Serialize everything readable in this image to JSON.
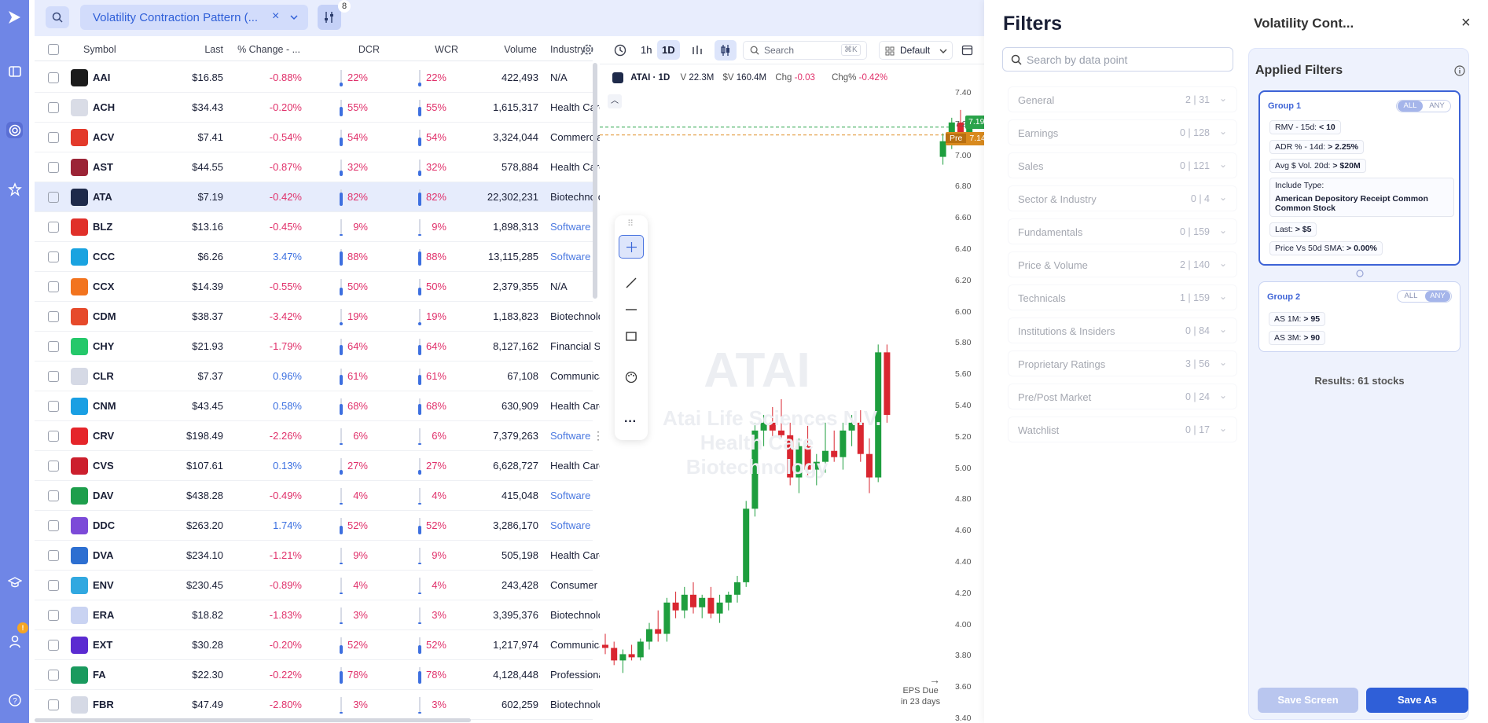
{
  "toolbar": {
    "screen_name": "Volatility Contraction Pattern (...",
    "filter_count": "8"
  },
  "table": {
    "headers": {
      "symbol": "Symbol",
      "last": "Last",
      "change": "% Change - ...",
      "dcr": "DCR",
      "wcr": "WCR",
      "volume": "Volume",
      "industry": "Industry"
    },
    "rows": [
      {
        "symbol": "AAI",
        "last": "$16.85",
        "change": "-0.88%",
        "dcr": "22%",
        "dcr_value": 22,
        "wcr": "22%",
        "volume": "422,493",
        "industry": "N/A",
        "logo_color": "#1b1b1b",
        "negative": true,
        "industry_link": false
      },
      {
        "symbol": "ACH",
        "last": "$34.43",
        "change": "-0.20%",
        "dcr": "55%",
        "dcr_value": 55,
        "wcr": "55%",
        "volume": "1,615,317",
        "industry": "Health Care ...",
        "logo_color": "#d9dce6",
        "negative": true,
        "industry_link": false
      },
      {
        "symbol": "ACV",
        "last": "$7.41",
        "change": "-0.54%",
        "dcr": "54%",
        "dcr_value": 54,
        "wcr": "54%",
        "volume": "3,324,044",
        "industry": "Commercial ...",
        "logo_color": "#e33a2b",
        "negative": true,
        "industry_link": false
      },
      {
        "symbol": "AST",
        "last": "$44.55",
        "change": "-0.87%",
        "dcr": "32%",
        "dcr_value": 32,
        "wcr": "32%",
        "volume": "578,884",
        "industry": "Health Care ...",
        "logo_color": "#9b2436",
        "negative": true,
        "industry_link": false
      },
      {
        "symbol": "ATA",
        "last": "$7.19",
        "change": "-0.42%",
        "dcr": "82%",
        "dcr_value": 82,
        "wcr": "82%",
        "volume": "22,302,231",
        "industry": "Biotechnology",
        "logo_color": "#1e2a4a",
        "negative": true,
        "industry_link": false,
        "selected": true
      },
      {
        "symbol": "BLZ",
        "last": "$13.16",
        "change": "-0.45%",
        "dcr": "9%",
        "dcr_value": 9,
        "wcr": "9%",
        "volume": "1,898,313",
        "industry": "Software",
        "logo_color": "#e0302a",
        "negative": true,
        "industry_link": true
      },
      {
        "symbol": "CCC",
        "last": "$6.26",
        "change": "3.47%",
        "dcr": "88%",
        "dcr_value": 88,
        "wcr": "88%",
        "volume": "13,115,285",
        "industry": "Software",
        "logo_color": "#1aa3e0",
        "negative": false,
        "industry_link": true
      },
      {
        "symbol": "CCX",
        "last": "$14.39",
        "change": "-0.55%",
        "dcr": "50%",
        "dcr_value": 50,
        "wcr": "50%",
        "volume": "2,379,355",
        "industry": "N/A",
        "logo_color": "#f2741f",
        "negative": true,
        "industry_link": false
      },
      {
        "symbol": "CDM",
        "last": "$38.37",
        "change": "-3.42%",
        "dcr": "19%",
        "dcr_value": 19,
        "wcr": "19%",
        "volume": "1,183,823",
        "industry": "Biotechnology",
        "logo_color": "#e64a2b",
        "negative": true,
        "industry_link": false
      },
      {
        "symbol": "CHY",
        "last": "$21.93",
        "change": "-1.79%",
        "dcr": "64%",
        "dcr_value": 64,
        "wcr": "64%",
        "volume": "8,127,162",
        "industry": "Financial Ser...",
        "logo_color": "#25c86a",
        "negative": true,
        "industry_link": false
      },
      {
        "symbol": "CLR",
        "last": "$7.37",
        "change": "0.96%",
        "dcr": "61%",
        "dcr_value": 61,
        "wcr": "61%",
        "volume": "67,108",
        "industry": "Communicati...",
        "logo_color": "#d5d9e5",
        "negative": false,
        "industry_link": false
      },
      {
        "symbol": "CNM",
        "last": "$43.45",
        "change": "0.58%",
        "dcr": "68%",
        "dcr_value": 68,
        "wcr": "68%",
        "volume": "630,909",
        "industry": "Health Care ...",
        "logo_color": "#1a9fe3",
        "negative": false,
        "industry_link": false
      },
      {
        "symbol": "CRV",
        "last": "$198.49",
        "change": "-2.26%",
        "dcr": "6%",
        "dcr_value": 6,
        "wcr": "6%",
        "volume": "7,379,263",
        "industry": "Software",
        "logo_color": "#e5252a",
        "negative": true,
        "industry_link": true
      },
      {
        "symbol": "CVS",
        "last": "$107.61",
        "change": "0.13%",
        "dcr": "27%",
        "dcr_value": 27,
        "wcr": "27%",
        "volume": "6,628,727",
        "industry": "Health Care ...",
        "logo_color": "#cc1f2d",
        "negative": false,
        "industry_link": false
      },
      {
        "symbol": "DAV",
        "last": "$438.28",
        "change": "-0.49%",
        "dcr": "4%",
        "dcr_value": 4,
        "wcr": "4%",
        "volume": "415,048",
        "industry": "Software",
        "logo_color": "#1e9e4c",
        "negative": true,
        "industry_link": true
      },
      {
        "symbol": "DDC",
        "last": "$263.20",
        "change": "1.74%",
        "dcr": "52%",
        "dcr_value": 52,
        "wcr": "52%",
        "volume": "3,286,170",
        "industry": "Software",
        "logo_color": "#7c4ad8",
        "negative": false,
        "industry_link": true
      },
      {
        "symbol": "DVA",
        "last": "$234.10",
        "change": "-1.21%",
        "dcr": "9%",
        "dcr_value": 9,
        "wcr": "9%",
        "volume": "505,198",
        "industry": "Health Care ...",
        "logo_color": "#2d6fd1",
        "negative": true,
        "industry_link": false
      },
      {
        "symbol": "ENV",
        "last": "$230.45",
        "change": "-0.89%",
        "dcr": "4%",
        "dcr_value": 4,
        "wcr": "4%",
        "volume": "243,428",
        "industry": "Consumer Fi...",
        "logo_color": "#31a8e0",
        "negative": true,
        "industry_link": false
      },
      {
        "symbol": "ERA",
        "last": "$18.82",
        "change": "-1.83%",
        "dcr": "3%",
        "dcr_value": 3,
        "wcr": "3%",
        "volume": "3,395,376",
        "industry": "Biotechnology",
        "logo_color": "#c9d3f2",
        "negative": true,
        "industry_link": false
      },
      {
        "symbol": "EXT",
        "last": "$30.28",
        "change": "-0.20%",
        "dcr": "52%",
        "dcr_value": 52,
        "wcr": "52%",
        "volume": "1,217,974",
        "industry": "Communicati...",
        "logo_color": "#5b2bd1",
        "negative": true,
        "industry_link": false
      },
      {
        "symbol": "FA",
        "last": "$22.30",
        "change": "-0.22%",
        "dcr": "78%",
        "dcr_value": 78,
        "wcr": "78%",
        "volume": "4,128,448",
        "industry": "Professional ...",
        "logo_color": "#1a9a5e",
        "negative": true,
        "industry_link": false
      },
      {
        "symbol": "FBR",
        "last": "$47.49",
        "change": "-2.80%",
        "dcr": "3%",
        "dcr_value": 3,
        "wcr": "3%",
        "volume": "602,259",
        "industry": "Biotechnology",
        "logo_color": "#d5d9e5",
        "negative": true,
        "industry_link": false
      }
    ]
  },
  "chart": {
    "interval_1h": "1h",
    "interval_1d": "1D",
    "search_placeholder": "Search",
    "search_shortcut": "⌘K",
    "layout": "Default",
    "symbol": "ATAI · 1D",
    "v_label": "V",
    "volume": "22.3M",
    "dollar_label": "$V",
    "dollar_volume": "160.4M",
    "chg_label": "Chg",
    "chg": "-0.03",
    "chgp_label": "Chg%",
    "chgp": "-0.42%",
    "watermark_ticker": "ATAI",
    "watermark_line1": "Atai Life Sciences N.V.",
    "watermark_line2": "Health Care",
    "watermark_line3": "Biotechnology",
    "price_tag": "7.19",
    "pre_label": "Pre",
    "pre_price": "7.14",
    "eps_line1": "EPS Due",
    "eps_line2": "in 23 days",
    "y_ticks": [
      "7.40",
      "7.20",
      "7.00",
      "6.80",
      "6.60",
      "6.40",
      "6.20",
      "6.00",
      "5.80",
      "5.60",
      "5.40",
      "5.20",
      "5.00",
      "4.80",
      "4.60",
      "4.40",
      "4.20",
      "4.00",
      "3.80",
      "3.60",
      "3.40"
    ]
  },
  "filters": {
    "title": "Filters",
    "search_placeholder": "Search by data point",
    "screen_title": "Volatility Cont...",
    "categories": [
      {
        "name": "General",
        "active": "2",
        "total": "31"
      },
      {
        "name": "Earnings",
        "active": "0",
        "total": "128"
      },
      {
        "name": "Sales",
        "active": "0",
        "total": "121"
      },
      {
        "name": "Sector & Industry",
        "active": "0",
        "total": "4"
      },
      {
        "name": "Fundamentals",
        "active": "0",
        "total": "159"
      },
      {
        "name": "Price & Volume",
        "active": "2",
        "total": "140"
      },
      {
        "name": "Technicals",
        "active": "1",
        "total": "159"
      },
      {
        "name": "Institutions & Insiders",
        "active": "0",
        "total": "84"
      },
      {
        "name": "Proprietary Ratings",
        "active": "3",
        "total": "56"
      },
      {
        "name": "Pre/Post Market",
        "active": "0",
        "total": "24"
      },
      {
        "name": "Watchlist",
        "active": "0",
        "total": "17"
      }
    ],
    "applied_title": "Applied Filters",
    "group1": {
      "title": "Group 1",
      "all": "ALL",
      "any": "ANY",
      "rmv_label": "RMV - 15d:",
      "rmv_val": "< 10",
      "adr_label": "ADR % - 14d:",
      "adr_val": "> 2.25%",
      "avg_label": "Avg $ Vol. 20d:",
      "avg_val": "> $20M",
      "include_label": "Include Type:",
      "include_val1": "American Depository Receipt Common",
      "include_val2": "Common Stock",
      "last_label": "Last:",
      "last_val": "> $5",
      "sma_label": "Price Vs 50d SMA:",
      "sma_val": "> 0.00%"
    },
    "group2": {
      "title": "Group 2",
      "all": "ALL",
      "any": "ANY",
      "as1_label": "AS 1M:",
      "as1_val": "> 95",
      "as3_label": "AS 3M:",
      "as3_val": "> 90"
    },
    "results": "Results: 61 stocks",
    "save_screen": "Save Screen",
    "save_as": "Save As"
  },
  "candles": [
    [
      3.88,
      3.95,
      3.82,
      3.86
    ],
    [
      3.86,
      3.9,
      3.75,
      3.78
    ],
    [
      3.78,
      3.85,
      3.7,
      3.82
    ],
    [
      3.82,
      3.88,
      3.78,
      3.8
    ],
    [
      3.8,
      3.92,
      3.78,
      3.9
    ],
    [
      3.9,
      4.02,
      3.85,
      3.98
    ],
    [
      3.98,
      4.1,
      3.9,
      3.95
    ],
    [
      3.95,
      4.18,
      3.9,
      4.15
    ],
    [
      4.15,
      4.22,
      4.05,
      4.1
    ],
    [
      4.1,
      4.25,
      4.05,
      4.2
    ],
    [
      4.2,
      4.28,
      4.08,
      4.12
    ],
    [
      4.12,
      4.2,
      4.05,
      4.18
    ],
    [
      4.18,
      4.25,
      4.05,
      4.08
    ],
    [
      4.08,
      4.2,
      4.02,
      4.15
    ],
    [
      4.15,
      4.22,
      4.1,
      4.2
    ],
    [
      4.2,
      4.32,
      4.15,
      4.28
    ],
    [
      4.28,
      4.8,
      4.25,
      4.75
    ],
    [
      4.75,
      5.3,
      4.7,
      5.25
    ],
    [
      5.25,
      5.35,
      5.15,
      5.3
    ],
    [
      5.3,
      5.4,
      5.2,
      5.25
    ],
    [
      5.25,
      5.45,
      5.2,
      5.22
    ],
    [
      5.22,
      5.3,
      4.9,
      4.95
    ],
    [
      4.95,
      5.2,
      4.85,
      5.15
    ],
    [
      5.15,
      5.28,
      4.95,
      5.0
    ],
    [
      5.0,
      5.1,
      4.9,
      5.05
    ],
    [
      5.05,
      5.3,
      4.98,
      5.12
    ],
    [
      5.12,
      5.25,
      5.05,
      5.08
    ],
    [
      5.08,
      5.3,
      5.0,
      5.25
    ],
    [
      5.25,
      5.35,
      5.15,
      5.3
    ],
    [
      5.3,
      5.38,
      5.05,
      5.1
    ],
    [
      5.1,
      5.2,
      4.85,
      4.95
    ],
    [
      4.95,
      5.8,
      4.92,
      5.75
    ],
    [
      5.75,
      5.8,
      5.3,
      5.35
    ],
    [
      7.0,
      7.15,
      6.95,
      7.1
    ],
    [
      7.1,
      7.25,
      7.05,
      7.22
    ],
    [
      7.22,
      7.3,
      7.1,
      7.15
    ],
    [
      7.15,
      7.2,
      7.08,
      7.19
    ]
  ]
}
